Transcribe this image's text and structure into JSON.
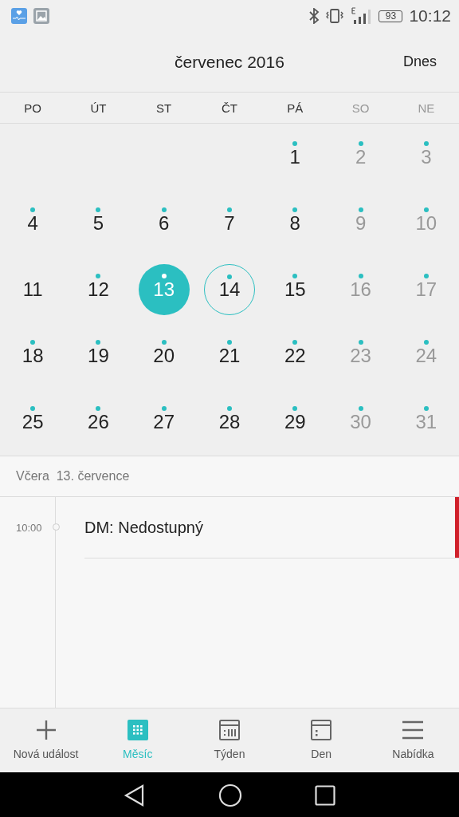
{
  "status_bar": {
    "battery": "93",
    "time": "10:12"
  },
  "header": {
    "title": "červenec 2016",
    "today_button": "Dnes"
  },
  "weekdays": [
    {
      "label": "PO",
      "weekend": false
    },
    {
      "label": "ÚT",
      "weekend": false
    },
    {
      "label": "ST",
      "weekend": false
    },
    {
      "label": "ČT",
      "weekend": false
    },
    {
      "label": "PÁ",
      "weekend": false
    },
    {
      "label": "SO",
      "weekend": true
    },
    {
      "label": "NE",
      "weekend": true
    }
  ],
  "weeks": [
    [
      {
        "day": "1",
        "has_event": true,
        "selected": false,
        "today": false
      },
      {
        "day": "2",
        "has_event": true,
        "selected": false,
        "today": false
      },
      {
        "day": "3",
        "has_event": true,
        "selected": false,
        "today": false
      }
    ],
    [
      {
        "day": "4",
        "has_event": true,
        "selected": false,
        "today": false
      },
      {
        "day": "5",
        "has_event": true,
        "selected": false,
        "today": false
      },
      {
        "day": "6",
        "has_event": true,
        "selected": false,
        "today": false
      },
      {
        "day": "7",
        "has_event": true,
        "selected": false,
        "today": false
      },
      {
        "day": "8",
        "has_event": true,
        "selected": false,
        "today": false
      },
      {
        "day": "9",
        "has_event": true,
        "selected": false,
        "today": false
      },
      {
        "day": "10",
        "has_event": true,
        "selected": false,
        "today": false
      }
    ],
    [
      {
        "day": "11",
        "has_event": false,
        "selected": false,
        "today": false
      },
      {
        "day": "12",
        "has_event": true,
        "selected": false,
        "today": false
      },
      {
        "day": "13",
        "has_event": true,
        "selected": true,
        "today": false
      },
      {
        "day": "14",
        "has_event": true,
        "selected": false,
        "today": true
      },
      {
        "day": "15",
        "has_event": true,
        "selected": false,
        "today": false
      },
      {
        "day": "16",
        "has_event": true,
        "selected": false,
        "today": false
      },
      {
        "day": "17",
        "has_event": true,
        "selected": false,
        "today": false
      }
    ],
    [
      {
        "day": "18",
        "has_event": true,
        "selected": false,
        "today": false
      },
      {
        "day": "19",
        "has_event": true,
        "selected": false,
        "today": false
      },
      {
        "day": "20",
        "has_event": true,
        "selected": false,
        "today": false
      },
      {
        "day": "21",
        "has_event": true,
        "selected": false,
        "today": false
      },
      {
        "day": "22",
        "has_event": true,
        "selected": false,
        "today": false
      },
      {
        "day": "23",
        "has_event": true,
        "selected": false,
        "today": false
      },
      {
        "day": "24",
        "has_event": true,
        "selected": false,
        "today": false
      }
    ],
    [
      {
        "day": "25",
        "has_event": true,
        "selected": false,
        "today": false
      },
      {
        "day": "26",
        "has_event": true,
        "selected": false,
        "today": false
      },
      {
        "day": "27",
        "has_event": true,
        "selected": false,
        "today": false
      },
      {
        "day": "28",
        "has_event": true,
        "selected": false,
        "today": false
      },
      {
        "day": "29",
        "has_event": true,
        "selected": false,
        "today": false
      },
      {
        "day": "30",
        "has_event": true,
        "selected": false,
        "today": false
      },
      {
        "day": "31",
        "has_event": true,
        "selected": false,
        "today": false
      }
    ]
  ],
  "agenda": {
    "date_heading": "Včera  13. července",
    "events": [
      {
        "time": "10:00",
        "title": "DM: Nedostupný",
        "color": "#d0202a"
      }
    ]
  },
  "bottom_nav": [
    {
      "label": "Nová událost",
      "kind": "add",
      "selected": false
    },
    {
      "label": "Měsíc",
      "kind": "month",
      "selected": true
    },
    {
      "label": "Týden",
      "kind": "week",
      "selected": false
    },
    {
      "label": "Den",
      "kind": "day",
      "selected": false
    },
    {
      "label": "Nabídka",
      "kind": "menu",
      "selected": false
    }
  ]
}
